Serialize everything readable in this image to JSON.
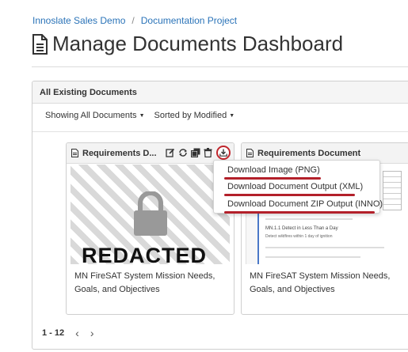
{
  "breadcrumb": {
    "items": [
      "Innoslate Sales Demo",
      "Documentation Project"
    ],
    "separator": "/"
  },
  "page": {
    "title": "Manage Documents Dashboard",
    "title_icon": "document-icon"
  },
  "panel": {
    "header": "All Existing Documents",
    "filter_label": "Showing All Documents",
    "sort_label": "Sorted by Modified"
  },
  "cards": [
    {
      "title": "Requirements D...",
      "caption": "MN FireSAT System Mission Needs, Goals, and Objectives",
      "thumbnail": "redacted",
      "redacted_text": "REDACTED",
      "actions": [
        "edit-icon",
        "sync-icon",
        "copy-icon",
        "trash-icon",
        "download-icon"
      ]
    },
    {
      "title": "Requirements Document",
      "caption": "MN FireSAT System Mission Needs, Goals, and Objectives",
      "thumbnail": "document-preview",
      "preview_heading": "MN.1.1 Detect in Less Than a Day",
      "preview_text": "Detect wildfires within 1 day of ignition"
    }
  ],
  "download_menu": {
    "items": [
      "Download Image (PNG)",
      "Download Document Output (XML)",
      "Download Document ZIP Output (INNO)"
    ]
  },
  "pagination": {
    "range": "1 - 12"
  },
  "colors": {
    "link": "#2a73b8",
    "highlight": "#b3202a"
  }
}
